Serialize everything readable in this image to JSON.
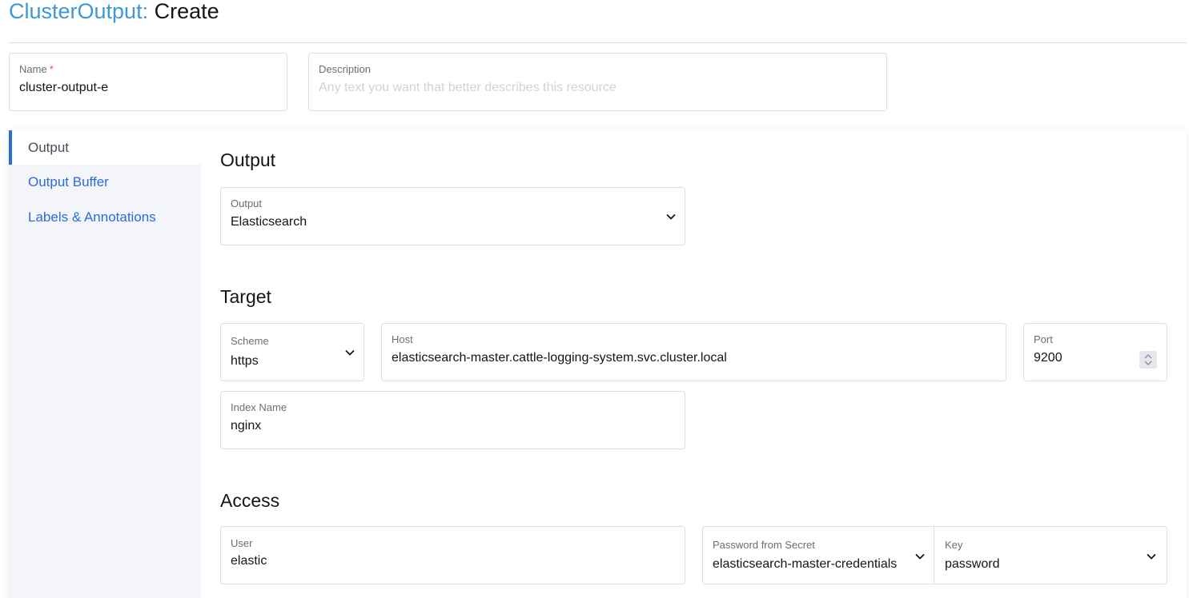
{
  "header": {
    "resource": "ClusterOutput:",
    "action": "Create"
  },
  "name_field": {
    "label": "Name",
    "required_mark": "*",
    "value": "cluster-output-e"
  },
  "description_field": {
    "label": "Description",
    "placeholder": "Any text you want that better describes this resource"
  },
  "tabs": [
    {
      "label": "Output",
      "active": true
    },
    {
      "label": "Output Buffer",
      "active": false
    },
    {
      "label": "Labels & Annotations",
      "active": false
    }
  ],
  "output_section": {
    "heading": "Output",
    "output_select": {
      "label": "Output",
      "value": "Elasticsearch"
    }
  },
  "target_section": {
    "heading": "Target",
    "scheme": {
      "label": "Scheme",
      "value": "https"
    },
    "host": {
      "label": "Host",
      "value": "elasticsearch-master.cattle-logging-system.svc.cluster.local"
    },
    "port": {
      "label": "Port",
      "value": "9200"
    },
    "index_name": {
      "label": "Index Name",
      "value": "nginx"
    }
  },
  "access_section": {
    "heading": "Access",
    "user": {
      "label": "User",
      "value": "elastic"
    },
    "password_secret": {
      "label": "Password from Secret",
      "value": "elasticsearch-master-credentials"
    },
    "password_key": {
      "label": "Key",
      "value": "password"
    }
  },
  "colors": {
    "accent": "#2b6cdc",
    "title_resource": "#3d98d3",
    "required": "#f64747",
    "border": "#dcdee7",
    "sidebar_bg": "#f4f5fa"
  }
}
